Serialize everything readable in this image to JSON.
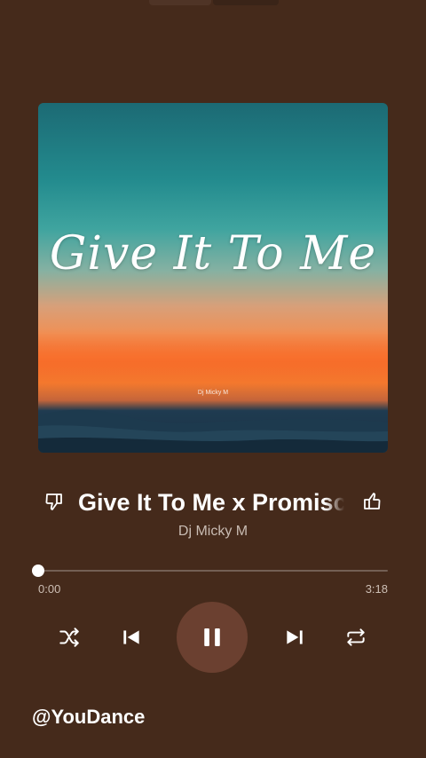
{
  "album": {
    "art_title": "Give It To Me",
    "art_artist": "Dj Micky M"
  },
  "track": {
    "title": "Give It To Me x Promiscu",
    "artist": "Dj Micky M"
  },
  "playback": {
    "current_time": "0:00",
    "total_time": "3:18",
    "progress": 0.0,
    "state": "playing"
  },
  "controls": {
    "icons": [
      "shuffle-icon",
      "previous-icon",
      "pause-icon",
      "next-icon",
      "repeat-icon"
    ]
  },
  "watermark": "@YouDance",
  "colors": {
    "background": "#452a1b",
    "play_button": "#6b4030",
    "text_primary": "#ffffff",
    "text_secondary": "#c9bcb3"
  }
}
